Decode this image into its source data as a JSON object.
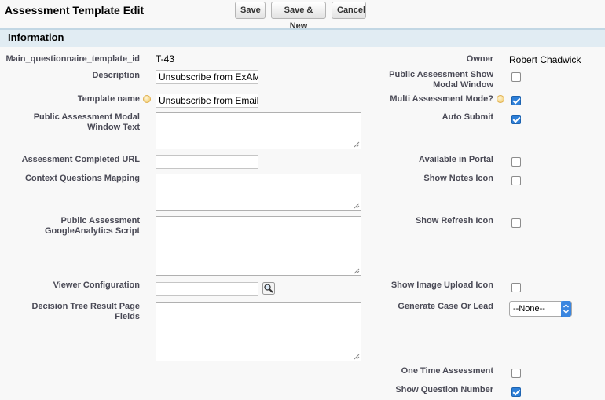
{
  "page": {
    "title": "Assessment Template Edit"
  },
  "toolbar": {
    "save_label": "Save",
    "save_new_label": "Save & New",
    "cancel_label": "Cancel"
  },
  "section": {
    "title": "Information"
  },
  "left_fields": {
    "template_id_label": "Main_questionnaire_template_id",
    "template_id_value": "T-43",
    "description_label": "Description",
    "description_value": "Unsubscribe from ExAM",
    "template_name_label": "Template name",
    "template_name_value": "Unsubscribe from Email",
    "modal_text_label_1": "Public Assessment Modal",
    "modal_text_label_2": "Window Text",
    "completed_url_label": "Assessment Completed URL",
    "context_mapping_label": "Context Questions Mapping",
    "ga_script_label_1": "Public Assessment",
    "ga_script_label_2": "GoogleAnalytics Script",
    "viewer_config_label": "Viewer Configuration",
    "decision_tree_label_1": "Decision Tree Result Page",
    "decision_tree_label_2": "Fields"
  },
  "right_fields": {
    "owner_label": "Owner",
    "owner_value": "Robert Chadwick",
    "show_modal_label_1": "Public Assessment Show",
    "show_modal_label_2": "Modal Window",
    "show_modal_checked": false,
    "multi_mode_label": "Multi Assessment Mode?",
    "multi_mode_checked": true,
    "auto_submit_label": "Auto Submit",
    "auto_submit_checked": true,
    "available_portal_label": "Available in Portal",
    "available_portal_checked": false,
    "notes_icon_label": "Show Notes Icon",
    "notes_icon_checked": false,
    "refresh_icon_label": "Show Refresh Icon",
    "refresh_icon_checked": false,
    "image_upload_label": "Show Image Upload Icon",
    "image_upload_checked": false,
    "generate_case_label": "Generate Case Or Lead",
    "generate_case_value": "--None--",
    "one_time_label": "One Time Assessment",
    "one_time_checked": false,
    "question_number_label": "Show Question Number",
    "question_number_checked": true
  },
  "colors": {
    "section_bg": "#e1ecf3",
    "checkbox_checked": "#2d7fd8",
    "label_text": "#4a4a56"
  },
  "icons": {
    "help": "help-icon",
    "lookup": "magnifier-lookup-icon",
    "dropdown": "chevron-updown-icon"
  }
}
